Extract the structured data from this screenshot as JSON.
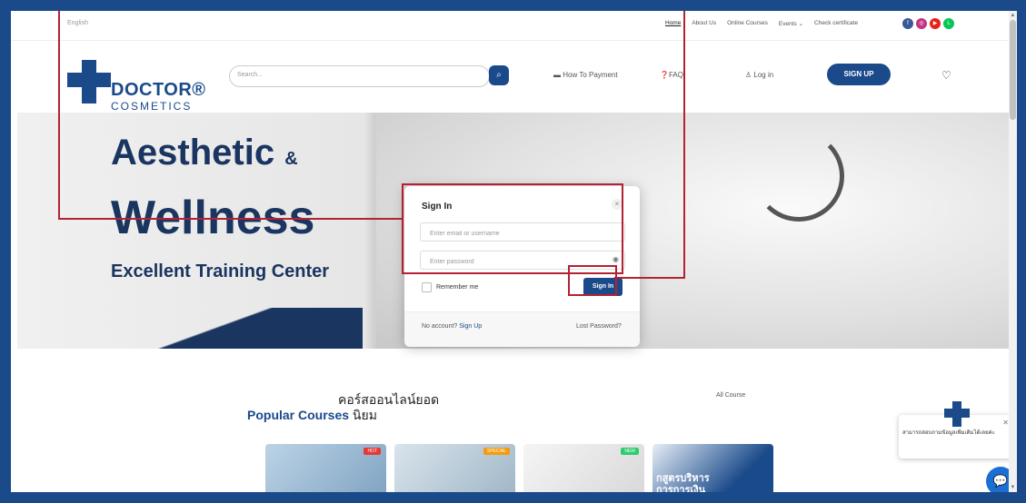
{
  "topbar": {
    "language": "English",
    "nav": [
      "Home",
      "About Us",
      "Online Courses",
      "Events",
      "Check certificate"
    ],
    "events_chevron": "⌄"
  },
  "social": [
    {
      "icon": "facebook-icon",
      "glyph": "f",
      "color": "#3b5998"
    },
    {
      "icon": "instagram-icon",
      "glyph": "◎",
      "color": "#c13584"
    },
    {
      "icon": "youtube-icon",
      "glyph": "▶",
      "color": "#e62117"
    },
    {
      "icon": "line-icon",
      "glyph": "L",
      "color": "#06c755"
    }
  ],
  "header": {
    "logo_text": "DOCTOR®",
    "logo_sub": "COSMETICS",
    "search_placeholder": "Search...",
    "how_to_payment": "How To Payment",
    "faq": "FAQ",
    "login": "Log in",
    "signup": "SIGN UP"
  },
  "hero": {
    "line1": "Aesthetic",
    "amp": "&",
    "line2": "Wellness",
    "line3": "Excellent Training Center"
  },
  "section": {
    "title_th": "คอร์สออนไลน์ยอด",
    "title_en": "Popular Courses",
    "title_th2": "นิยม",
    "all_course": "All Course"
  },
  "cards": [
    {
      "badge": "HOT",
      "badge_color": "#e53935"
    },
    {
      "badge": "SPECIAL",
      "badge_color": "#f39c12"
    },
    {
      "badge": "NEW",
      "badge_color": "#2ecc71"
    },
    {
      "badge": "",
      "title_th": "กสูตรบริหาร\nการการเงิน"
    }
  ],
  "modal": {
    "title": "Sign In",
    "email_placeholder": "Enter email or username",
    "password_placeholder": "Enter password",
    "remember": "Remember me",
    "signin_button": "Sign In",
    "no_account": "No account?",
    "sign_up_link": "Sign Up",
    "lost_password": "Lost Password?"
  },
  "chat": {
    "popup_text": "สามารถสอบถามข้อมูลเพิ่มเติมได้เลยค่ะ"
  }
}
